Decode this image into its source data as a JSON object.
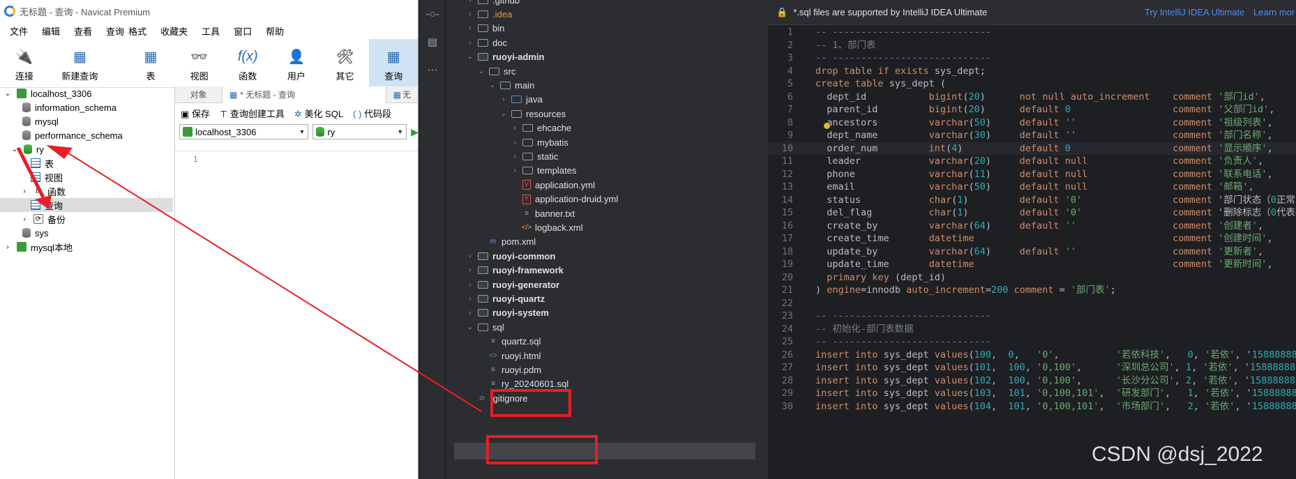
{
  "navicat": {
    "title": "无标题 - 查询 - Navicat Premium",
    "menu": [
      "文件",
      "编辑",
      "查看",
      "查询",
      "格式",
      "收藏夹",
      "工具",
      "窗口",
      "帮助"
    ],
    "toolbar": {
      "connect": "连接",
      "new_query": "新建查询",
      "table": "表",
      "view": "视图",
      "function": "函数",
      "user": "用户",
      "other": "其它",
      "query": "查询"
    },
    "tree": {
      "localhost": "localhost_3306",
      "information_schema": "information_schema",
      "mysql": "mysql",
      "performance_schema": "performance_schema",
      "ry": "ry",
      "ry_table": "表",
      "ry_view": "视图",
      "ry_function": "函数",
      "ry_query": "查询",
      "ry_backup": "备份",
      "sys": "sys",
      "mysql_local": "mysql本地"
    },
    "tabs": {
      "objects": "对象",
      "query_tab": "* 无标题 - 查询",
      "more": "无"
    },
    "query_toolbar": {
      "save": "保存",
      "builder": "查询创建工具",
      "beautify": "美化 SQL",
      "snippet": "代码段"
    },
    "connection_select": "localhost_3306",
    "database_select": "ry",
    "line1": "1"
  },
  "project": {
    "items": {
      "github": ".github",
      "idea": ".idea",
      "bin": "bin",
      "doc": "doc",
      "ruoyi_admin": "ruoyi-admin",
      "src": "src",
      "main": "main",
      "java": "java",
      "resources": "resources",
      "ehcache": "ehcache",
      "mybatis": "mybatis",
      "static": "static",
      "templates": "templates",
      "application_yml": "application.yml",
      "application_druid_yml": "application-druid.yml",
      "banner_txt": "banner.txt",
      "logback_xml": "logback.xml",
      "pom_xml": "pom.xml",
      "ruoyi_common": "ruoyi-common",
      "ruoyi_framework": "ruoyi-framework",
      "ruoyi_generator": "ruoyi-generator",
      "ruoyi_quartz": "ruoyi-quartz",
      "ruoyi_system": "ruoyi-system",
      "sql": "sql",
      "quartz_sql": "quartz.sql",
      "ruoyi_html": "ruoyi.html",
      "ruoyi_pdm": "ruoyi.pdm",
      "ry_sql": "ry_20240601.sql",
      "gitignore": ".gitignore"
    }
  },
  "editor": {
    "banner_text": "*.sql files are supported by IntelliJ IDEA Ultimate",
    "try_link": "Try IntelliJ IDEA Ultimate",
    "learn_link": "Learn mor",
    "lines": [
      {
        "n": "1",
        "t": "-- ----------------------------"
      },
      {
        "n": "2",
        "t": "-- 1、部门表"
      },
      {
        "n": "3",
        "t": "-- ----------------------------"
      },
      {
        "n": "4",
        "t": "drop table if exists sys_dept;"
      },
      {
        "n": "5",
        "t": "create table sys_dept ("
      },
      {
        "n": "6",
        "t": "  dept_id           bigint(20)      not null auto_increment    comment '部门id',"
      },
      {
        "n": "7",
        "t": "  parent_id         bigint(20)      default 0                  comment '父部门id',"
      },
      {
        "n": "8",
        "t": "  ancestors         varchar(50)     default ''                 comment '祖级列表',"
      },
      {
        "n": "9",
        "t": "  dept_name         varchar(30)     default ''                 comment '部门名称',"
      },
      {
        "n": "10",
        "t": "  order_num         int(4)          default 0                  comment '显示顺序',"
      },
      {
        "n": "11",
        "t": "  leader            varchar(20)     default null               comment '负责人',"
      },
      {
        "n": "12",
        "t": "  phone             varchar(11)     default null               comment '联系电话',"
      },
      {
        "n": "13",
        "t": "  email             varchar(50)     default null               comment '邮箱',"
      },
      {
        "n": "14",
        "t": "  status            char(1)         default '0'                comment '部门状态（0正常"
      },
      {
        "n": "15",
        "t": "  del_flag          char(1)         default '0'                comment '删除标志（0代表存"
      },
      {
        "n": "16",
        "t": "  create_by         varchar(64)     default ''                 comment '创建者',"
      },
      {
        "n": "17",
        "t": "  create_time       datetime                                   comment '创建时间',"
      },
      {
        "n": "18",
        "t": "  update_by         varchar(64)     default ''                 comment '更新者',"
      },
      {
        "n": "19",
        "t": "  update_time       datetime                                   comment '更新时间',"
      },
      {
        "n": "20",
        "t": "  primary key (dept_id)"
      },
      {
        "n": "21",
        "t": ") engine=innodb auto_increment=200 comment = '部门表';"
      },
      {
        "n": "22",
        "t": ""
      },
      {
        "n": "23",
        "t": "-- ----------------------------"
      },
      {
        "n": "24",
        "t": "-- 初始化-部门表数据"
      },
      {
        "n": "25",
        "t": "-- ----------------------------"
      },
      {
        "n": "26",
        "t": "insert into sys_dept values(100,  0,   '0',          '若依科技',   0, '若依', '1588888888"
      },
      {
        "n": "27",
        "t": "insert into sys_dept values(101,  100, '0,100',      '深圳总公司', 1, '若依', '1588888888"
      },
      {
        "n": "28",
        "t": "insert into sys_dept values(102,  100, '0,100',      '长沙分公司', 2, '若依', '1588888888"
      },
      {
        "n": "29",
        "t": "insert into sys_dept values(103,  101, '0,100,101',  '研发部门',   1, '若依', '1588888888"
      },
      {
        "n": "30",
        "t": "insert into sys_dept values(104,  101, '0,100,101',  '市场部门',   2, '若依', '1588888888"
      }
    ],
    "watermark": "CSDN @dsj_2022"
  }
}
